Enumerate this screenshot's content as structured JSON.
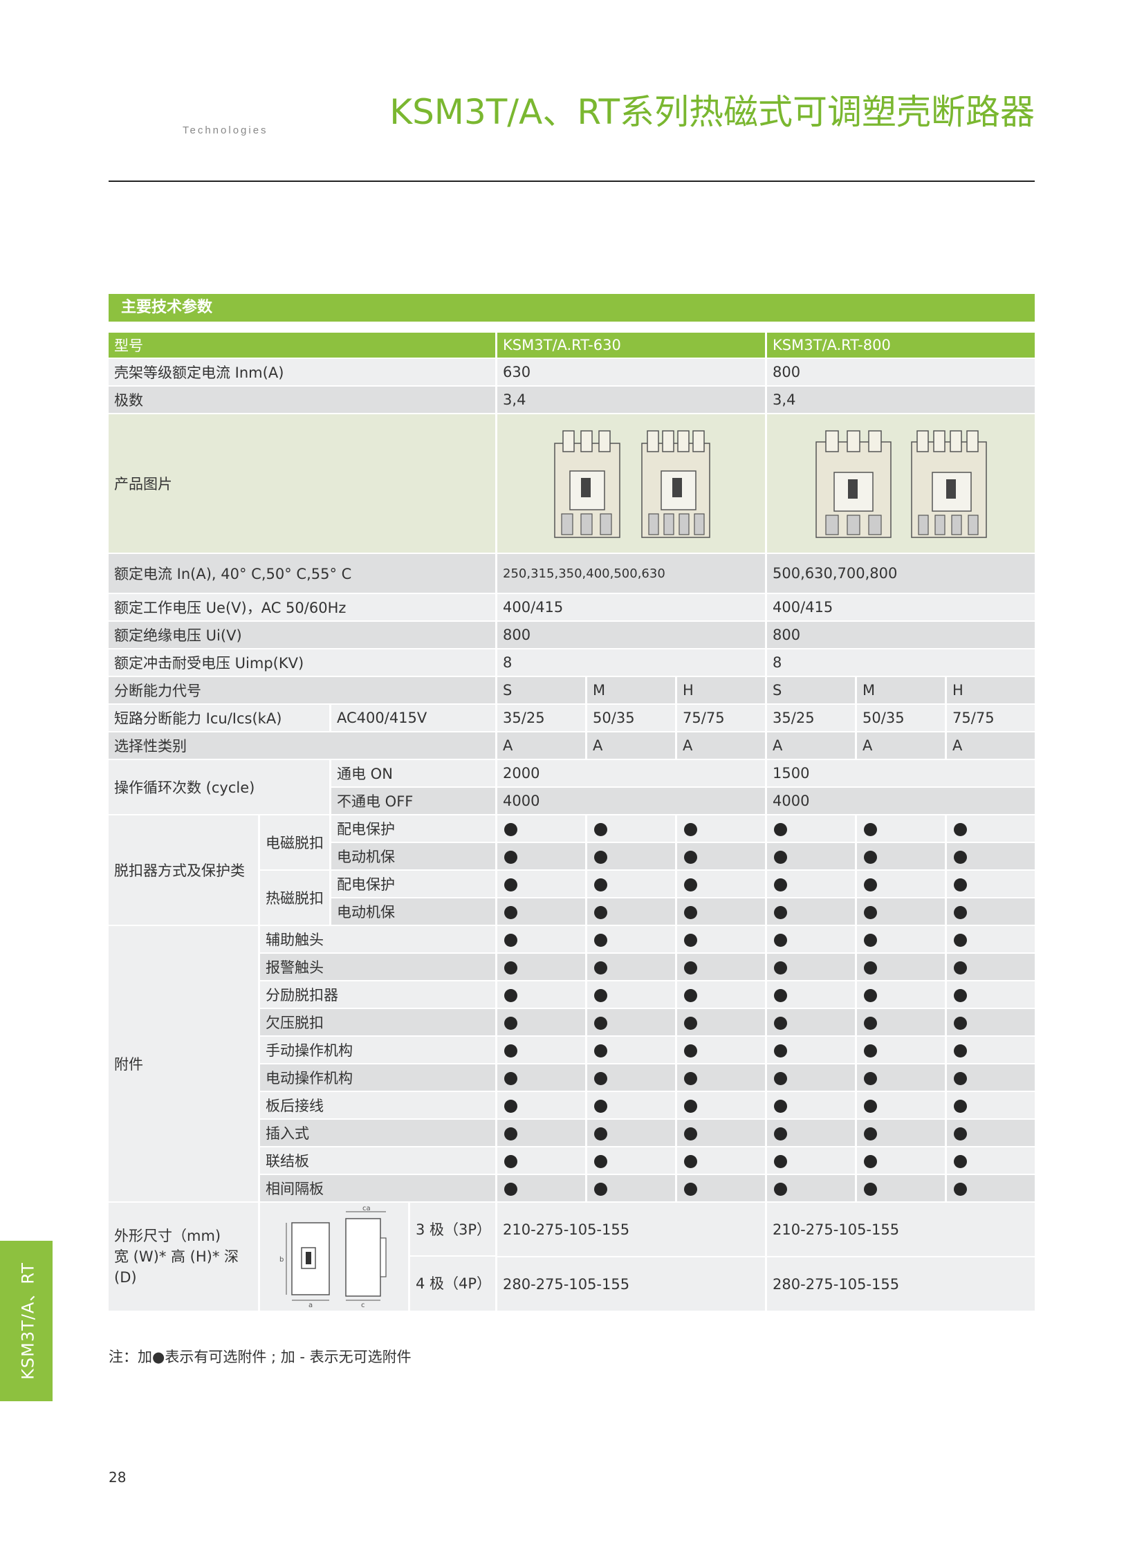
{
  "header": {
    "title": "KSM3T/A、RT系列热磁式可调塑壳断路器",
    "subtitle": "Technologies"
  },
  "section": {
    "title": "主要技术参数"
  },
  "table": {
    "col_model": "型号",
    "model_630": "KSM3T/A.RT-630",
    "model_800": "KSM3T/A.RT-800",
    "frame_current": {
      "label": "壳架等级额定电流 Inm(A)",
      "v630": "630",
      "v800": "800"
    },
    "poles": {
      "label": "极数",
      "v630": "3,4",
      "v800": "3,4"
    },
    "photo": {
      "label": "产品图片"
    },
    "rated_current": {
      "label": "额定电流 In(A), 40° C,50° C,55° C",
      "v630": "250,315,350,400,500,630",
      "v800": "500,630,700,800"
    },
    "ue": {
      "label": "额定工作电压 Ue(V)，AC 50/60Hz",
      "v630": "400/415",
      "v800": "400/415"
    },
    "ui": {
      "label": "额定绝缘电压 Ui(V)",
      "v630": "800",
      "v800": "800"
    },
    "uimp": {
      "label": "额定冲击耐受电压 Uimp(KV)",
      "v630": "8",
      "v800": "8"
    },
    "breaking_code": {
      "label": "分断能力代号",
      "values": [
        "S",
        "M",
        "H",
        "S",
        "M",
        "H"
      ]
    },
    "short_circuit": {
      "label": "短路分断能力 Icu/Ics(kA)",
      "sub": "AC400/415V",
      "values": [
        "35/25",
        "50/35",
        "75/75",
        "35/25",
        "50/35",
        "75/75"
      ]
    },
    "selectivity": {
      "label": "选择性类别",
      "values": [
        "A",
        "A",
        "A",
        "A",
        "A",
        "A"
      ]
    },
    "cycles": {
      "label": "操作循环次数 (cycle)",
      "on": {
        "label": "通电 ON",
        "v630": "2000",
        "v800": "1500"
      },
      "off": {
        "label": "不通电 OFF",
        "v630": "4000",
        "v800": "4000"
      }
    },
    "trip": {
      "label": "脱扣器方式及保护类",
      "em": "电磁脱扣",
      "tm": "热磁脱扣",
      "dist": "配电保护",
      "motor": "电动机保"
    },
    "accessories": {
      "label": "附件",
      "items": [
        "辅助触头",
        "报警触头",
        "分励脱扣器",
        "欠压脱扣",
        "手动操作机构",
        "电动操作机构",
        "板后接线",
        "插入式",
        "联结板",
        "相间隔板"
      ]
    },
    "dims": {
      "label1": "外形尺寸（mm)",
      "label2": "宽 (W)* 高 (H)* 深 (D)",
      "p3": "3 极（3P）",
      "p4": "4 极（4P）",
      "v630_3p": "210-275-105-155",
      "v630_4p": "280-275-105-155",
      "v800_3p": "210-275-105-155",
      "v800_4p": "280-275-105-155",
      "diagram_labels": {
        "top": "ca",
        "left": "b",
        "bottom1": "a",
        "bottom2": "c"
      }
    }
  },
  "note": "注：加●表示有可选附件 ; 加 - 表示无可选附件",
  "side_tab": "KSM3T/A、RT",
  "page_number": "28",
  "colors": {
    "accent": "#8dc13f",
    "title": "#7ab730",
    "dark_row": "#dedfe0",
    "light_row": "#eeeff0",
    "photo_bg": "#e5ead7"
  }
}
